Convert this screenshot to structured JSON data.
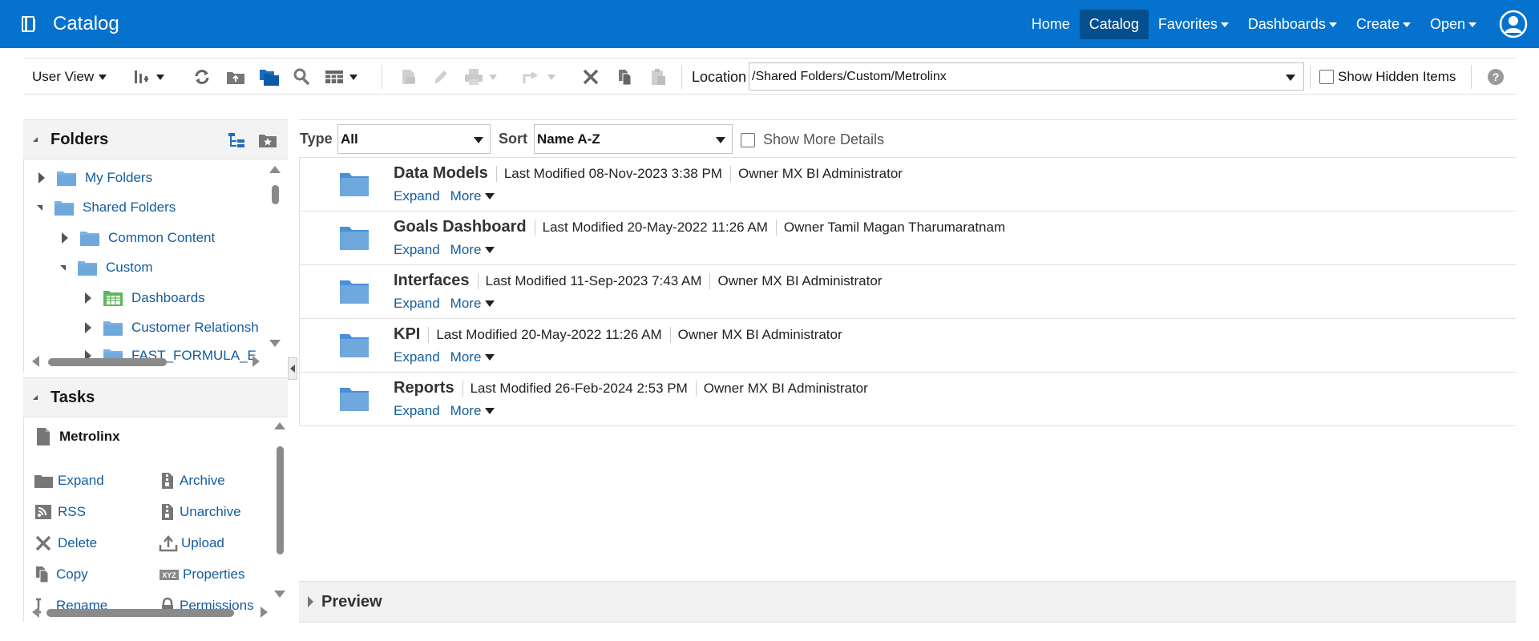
{
  "app": {
    "title": "Catalog"
  },
  "topnav": {
    "home": "Home",
    "catalog": "Catalog",
    "favorites": "Favorites",
    "dashboards": "Dashboards",
    "create": "Create",
    "open": "Open"
  },
  "toolbar": {
    "user_view": "User View",
    "location_label": "Location",
    "location_value": "/Shared Folders/Custom/Metrolinx",
    "show_hidden": "Show Hidden Items"
  },
  "folders": {
    "title": "Folders",
    "tree": [
      {
        "label": "My Folders"
      },
      {
        "label": "Shared Folders"
      },
      {
        "label": "Common Content"
      },
      {
        "label": "Custom"
      },
      {
        "label": "Dashboards"
      },
      {
        "label": "Customer Relationsh"
      },
      {
        "label": "FAST_FORMULA_E"
      }
    ]
  },
  "tasks": {
    "title": "Tasks",
    "selected": "Metrolinx",
    "items": [
      {
        "label": "Expand"
      },
      {
        "label": "Archive"
      },
      {
        "label": "RSS"
      },
      {
        "label": "Unarchive"
      },
      {
        "label": "Delete"
      },
      {
        "label": "Upload"
      },
      {
        "label": "Copy"
      },
      {
        "label": "Properties"
      },
      {
        "label": "Rename"
      },
      {
        "label": "Permissions"
      }
    ]
  },
  "filter": {
    "type_label": "Type",
    "type_value": "All",
    "sort_label": "Sort",
    "sort_value": "Name A-Z",
    "show_more": "Show More Details"
  },
  "items": [
    {
      "name": "Data Models",
      "modified": "Last Modified 08-Nov-2023 3:38 PM",
      "owner": "Owner MX BI Administrator",
      "expand": "Expand",
      "more": "More"
    },
    {
      "name": "Goals Dashboard",
      "modified": "Last Modified 20-May-2022 11:26 AM",
      "owner": "Owner Tamil Magan Tharumaratnam",
      "expand": "Expand",
      "more": "More"
    },
    {
      "name": "Interfaces",
      "modified": "Last Modified 11-Sep-2023 7:43 AM",
      "owner": "Owner MX BI Administrator",
      "expand": "Expand",
      "more": "More"
    },
    {
      "name": "KPI",
      "modified": "Last Modified 20-May-2022 11:26 AM",
      "owner": "Owner MX BI Administrator",
      "expand": "Expand",
      "more": "More"
    },
    {
      "name": "Reports",
      "modified": "Last Modified 26-Feb-2024 2:53 PM",
      "owner": "Owner MX BI Administrator",
      "expand": "Expand",
      "more": "More"
    }
  ],
  "preview": {
    "title": "Preview"
  },
  "colors": {
    "brand": "#0572ce",
    "link": "#145c9e",
    "folder": "#6fa8dc"
  }
}
